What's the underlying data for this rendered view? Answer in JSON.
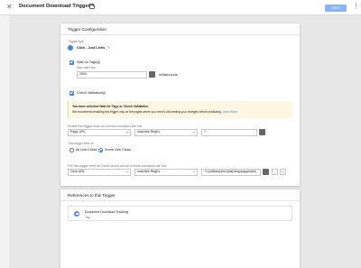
{
  "header": {
    "title": "Document Download Trigger",
    "save_label": "SAVE"
  },
  "config": {
    "section_title": "Trigger Configuration",
    "trigger_type_label": "Trigger type",
    "trigger_type_value": "Click - Just Links",
    "wait_for_tags": {
      "label": "Wait for Tags",
      "max_wait_label": "Max wait time",
      "max_wait_value": "2000",
      "unit": "milliseconds"
    },
    "check_validation_label": "Check Validation",
    "notice": {
      "line1": "You have selected Wait for Tags or Check Validation.",
      "line2": "We recommend enabling this trigger only on the pages where you need it and testing your changes before publishing.",
      "learn_more": "Learn More."
    },
    "enable_when_label": "Enable this trigger when all of these conditions are true",
    "enable_condition": {
      "variable": "Page URL",
      "operator": "matches RegEx",
      "value": ".*"
    },
    "fires_on_label": "This trigger fires on",
    "fires_on_options": [
      "All Link Clicks",
      "Some Link Clicks"
    ],
    "fires_on_selected": "Some Link Clicks",
    "fire_when_label": "Fire this trigger when an Event occurs and all of these conditions are true",
    "fire_condition": {
      "variable": "Click URL",
      "operator": "matches RegEx",
      "value": ".*\\.(pdf|doc|docx|xls|xlsx|ppt|pptx|txt)"
    },
    "remove_label": "-",
    "add_label": "+"
  },
  "references": {
    "section_title": "References to this Trigger",
    "items": [
      {
        "name": "Document Download Tracking",
        "type": "Tag"
      }
    ]
  },
  "colors": {
    "accent": "#4285f4",
    "notice_bg": "#fdf7e1"
  }
}
